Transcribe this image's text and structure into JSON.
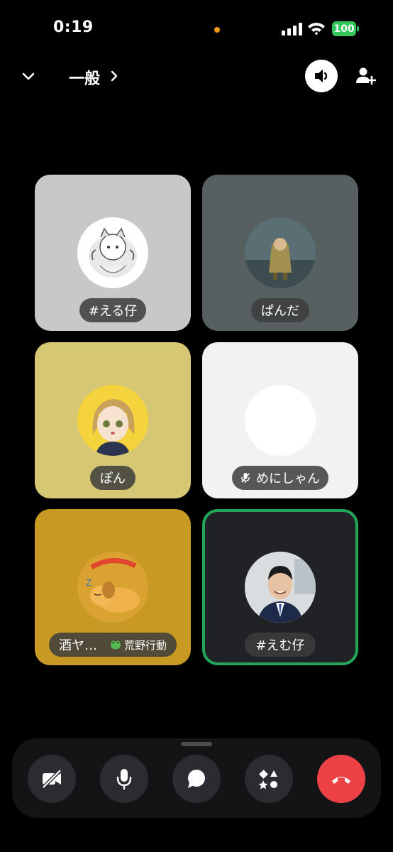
{
  "status_bar": {
    "time": "0:19",
    "battery": "100"
  },
  "header": {
    "channel": "一般"
  },
  "participants": [
    {
      "name": "#える仔",
      "tile_color": "#c8c8c8",
      "speaking": false
    },
    {
      "name": "ぱんだ",
      "tile_color": "#566060",
      "speaking": false
    },
    {
      "name": "ぽん",
      "tile_color": "#d6c774",
      "speaking": false
    },
    {
      "name": "めにしゃん",
      "tile_color": "#f2f2f2",
      "muted": true,
      "speaking": false
    },
    {
      "name": "酒ヤ…",
      "activity": "荒野行動",
      "tile_color": "#c89a24",
      "speaking": false
    },
    {
      "name": "#えむ仔",
      "tile_color": "#202226",
      "speaking": true
    }
  ],
  "controls": [
    "camera-off",
    "microphone",
    "chat",
    "activities",
    "end-call"
  ],
  "colors": {
    "speaking_ring": "#23a55a",
    "end_call": "#ed4245",
    "battery": "#34c759"
  }
}
